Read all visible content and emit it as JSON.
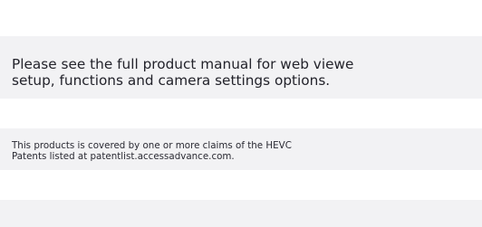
{
  "manual_notice": {
    "line1": "Please see the full product manual for web viewe",
    "line2": "setup, functions and camera settings options."
  },
  "patent_notice": {
    "line1": "This products is covered by one or more claims of the HEVC",
    "line2": "Patents listed at patentlist.accessadvance.com."
  },
  "colors": {
    "panel_background": "#f2f2f4",
    "page_background": "#ffffff",
    "text": "#23232b"
  }
}
